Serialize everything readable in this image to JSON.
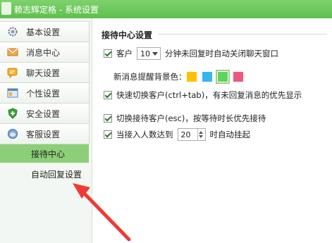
{
  "window": {
    "title": "赖志辉定格 - 系统设置"
  },
  "sidebar": {
    "items": [
      {
        "label": "基本设置",
        "icon": "gear-icon"
      },
      {
        "label": "消息中心",
        "icon": "envelope-icon"
      },
      {
        "label": "聊天设置",
        "icon": "chat-icon"
      },
      {
        "label": "个性设置",
        "icon": "window-icon"
      },
      {
        "label": "安全设置",
        "icon": "shield-icon"
      },
      {
        "label": "客服设置",
        "icon": "headset-icon"
      }
    ],
    "subitems": [
      {
        "label": "接待中心",
        "active": true
      },
      {
        "label": "自动回复设置",
        "active": false
      }
    ]
  },
  "main": {
    "section_title": "接待中心设置",
    "auto_close": {
      "prefix": "客户",
      "value": "10",
      "suffix": "分钟未回复时自动关闭聊天窗口"
    },
    "bg_color": {
      "label": "新消息提醒背景色：",
      "colors": [
        "#ffc000",
        "#35b6ef",
        "#5fd35a",
        "#f0577e"
      ],
      "selected": 2
    },
    "quick_switch": "快速切换客户(ctrl+tab)，有未回复消息的优先显示",
    "switch_reception": "切换接待客户(esc)，按等待时长优先接待",
    "limit": {
      "prefix": "当接入人数达到",
      "value": "20",
      "suffix": "时自动挂起"
    }
  },
  "colors": {
    "titlebar": "#6cc95a",
    "active_sub": "#8dcf78",
    "annotation_arrow": "#ee3b33"
  }
}
